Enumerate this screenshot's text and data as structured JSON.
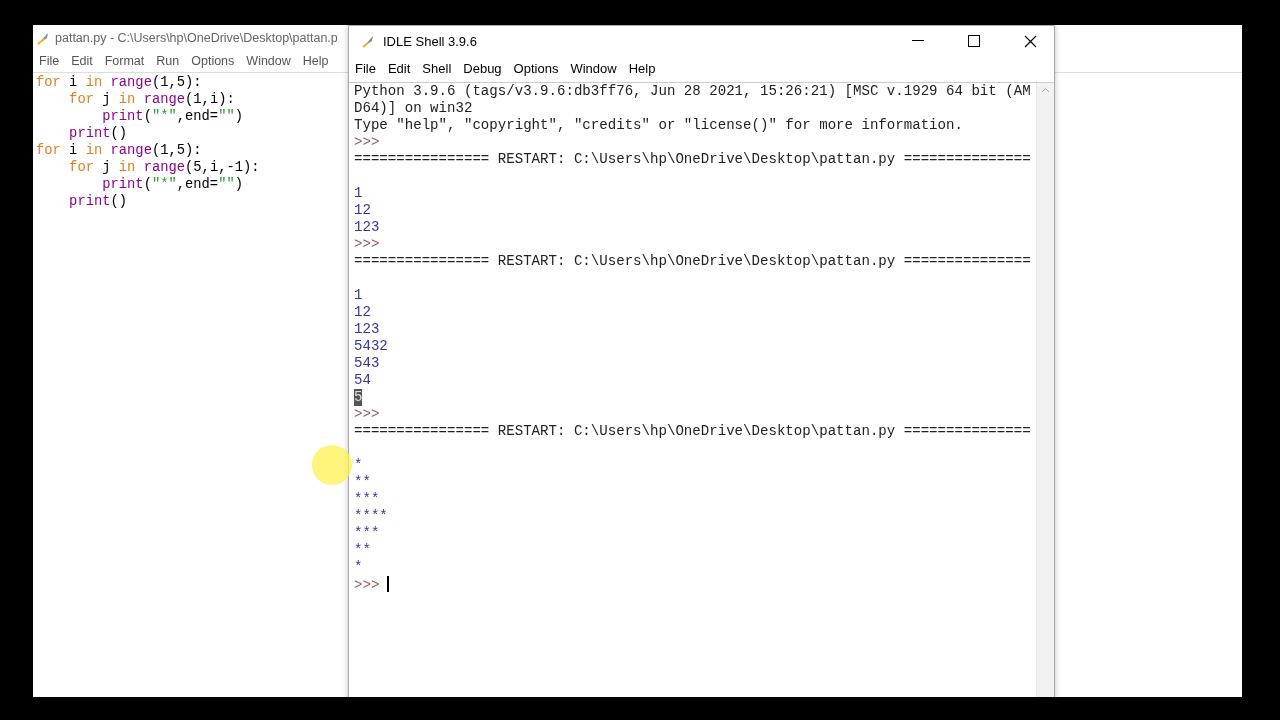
{
  "editor": {
    "title": "pattan.py - C:\\Users\\hp\\OneDrive\\Desktop\\pattan.p",
    "menu": [
      "File",
      "Edit",
      "Format",
      "Run",
      "Options",
      "Window",
      "Help"
    ],
    "code": [
      {
        "tokens": [
          {
            "kind": "keyword",
            "text": "for"
          },
          {
            "kind": "plain",
            "text": " i "
          },
          {
            "kind": "keyword",
            "text": "in "
          },
          {
            "kind": "builtin",
            "text": "range"
          },
          {
            "kind": "plain",
            "text": "(1,5):"
          }
        ],
        "children": [
          {
            "tokens": [
              {
                "kind": "keyword",
                "text": "for"
              },
              {
                "kind": "plain",
                "text": " j "
              },
              {
                "kind": "keyword",
                "text": "in "
              },
              {
                "kind": "builtin",
                "text": "range"
              },
              {
                "kind": "plain",
                "text": "(1,i):"
              }
            ],
            "children": [
              {
                "tokens": [
                  {
                    "kind": "builtin",
                    "text": "print"
                  },
                  {
                    "kind": "plain",
                    "text": "("
                  },
                  {
                    "kind": "string",
                    "text": "\"*\""
                  },
                  {
                    "kind": "plain",
                    "text": ",end="
                  },
                  {
                    "kind": "string",
                    "text": "\"\""
                  },
                  {
                    "kind": "plain",
                    "text": ")"
                  }
                ]
              }
            ]
          },
          {
            "tokens": [
              {
                "kind": "builtin",
                "text": "print"
              },
              {
                "kind": "plain",
                "text": "()"
              }
            ]
          }
        ]
      },
      {
        "tokens": [
          {
            "kind": "keyword",
            "text": "for"
          },
          {
            "kind": "plain",
            "text": " i "
          },
          {
            "kind": "keyword",
            "text": "in "
          },
          {
            "kind": "builtin",
            "text": "range"
          },
          {
            "kind": "plain",
            "text": "(1,5):"
          }
        ],
        "children": [
          {
            "tokens": [
              {
                "kind": "keyword",
                "text": "for"
              },
              {
                "kind": "plain",
                "text": " j "
              },
              {
                "kind": "keyword",
                "text": "in "
              },
              {
                "kind": "builtin",
                "text": "range"
              },
              {
                "kind": "plain",
                "text": "(5,i,-1):"
              }
            ],
            "children": [
              {
                "tokens": [
                  {
                    "kind": "builtin",
                    "text": "print"
                  },
                  {
                    "kind": "plain",
                    "text": "("
                  },
                  {
                    "kind": "string",
                    "text": "\"*\""
                  },
                  {
                    "kind": "plain",
                    "text": ",end="
                  },
                  {
                    "kind": "string",
                    "text": "\"\""
                  },
                  {
                    "kind": "plain",
                    "text": ")"
                  }
                ]
              }
            ]
          },
          {
            "tokens": [
              {
                "kind": "builtin",
                "text": "print"
              },
              {
                "kind": "plain",
                "text": "()"
              }
            ]
          }
        ]
      }
    ]
  },
  "shell": {
    "title": "IDLE Shell 3.9.6",
    "menu": [
      "File",
      "Edit",
      "Shell",
      "Debug",
      "Options",
      "Window",
      "Help"
    ],
    "lines": [
      {
        "kind": "info",
        "text": "Python 3.9.6 (tags/v3.9.6:db3ff76, Jun 28 2021, 15:26:21) [MSC v.1929 64 bit (AM",
        "selected": false
      },
      {
        "kind": "info",
        "text": "D64)] on win32",
        "selected": false
      },
      {
        "kind": "info",
        "text": "Type \"help\", \"copyright\", \"credits\" or \"license()\" for more information.",
        "selected": false
      },
      {
        "kind": "prompt",
        "text": ">>>",
        "selected": false
      },
      {
        "kind": "restart",
        "text": "================ RESTART: C:\\Users\\hp\\OneDrive\\Desktop\\pattan.py ===============",
        "selected": false
      },
      {
        "kind": "output",
        "text": "1",
        "selected": false
      },
      {
        "kind": "output",
        "text": "12",
        "selected": false
      },
      {
        "kind": "output",
        "text": "123",
        "selected": false
      },
      {
        "kind": "prompt",
        "text": ">>>",
        "selected": false
      },
      {
        "kind": "restart",
        "text": "================ RESTART: C:\\Users\\hp\\OneDrive\\Desktop\\pattan.py ===============",
        "selected": false
      },
      {
        "kind": "output",
        "text": "1",
        "selected": false
      },
      {
        "kind": "output",
        "text": "12",
        "selected": false
      },
      {
        "kind": "output",
        "text": "123",
        "selected": false
      },
      {
        "kind": "output",
        "text": "5432",
        "selected": false
      },
      {
        "kind": "output",
        "text": "543",
        "selected": false
      },
      {
        "kind": "output",
        "text": "54",
        "selected": false
      },
      {
        "kind": "output",
        "text": "5",
        "selected": true
      },
      {
        "kind": "prompt",
        "text": ">>>",
        "selected": false
      },
      {
        "kind": "restart",
        "text": "================ RESTART: C:\\Users\\hp\\OneDrive\\Desktop\\pattan.py ===============",
        "selected": false
      },
      {
        "kind": "output",
        "text": "*\n**\n***\n****\n***\n**\n*",
        "selected": false
      },
      {
        "kind": "prompt",
        "text": ">>>",
        "selected": false,
        "cursor": true
      }
    ]
  }
}
